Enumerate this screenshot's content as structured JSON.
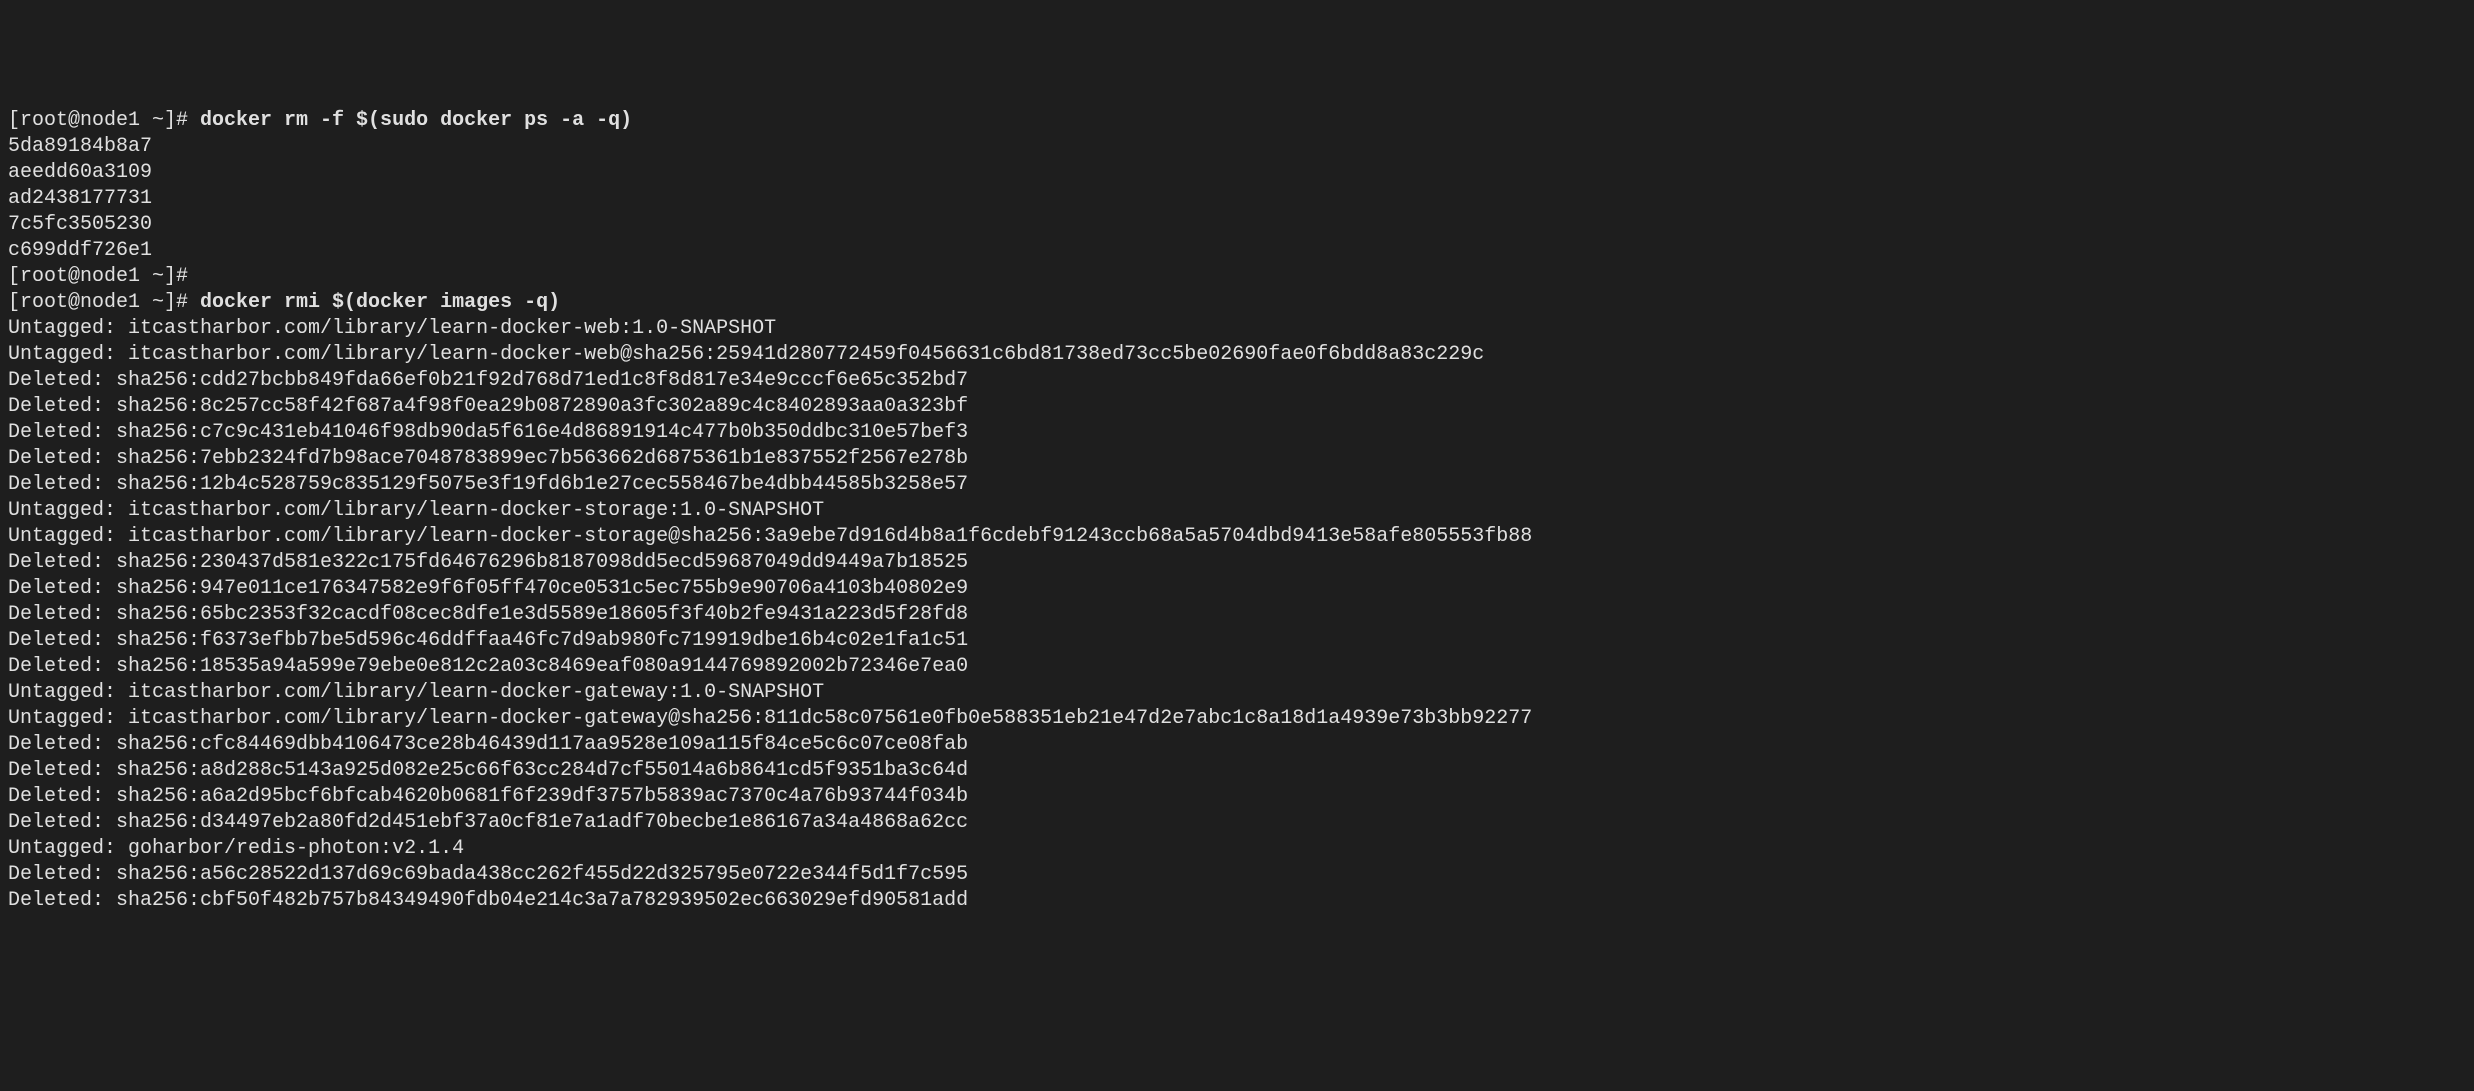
{
  "lines": [
    {
      "type": "prompt",
      "prompt": "[root@node1 ~]# ",
      "command": "docker rm -f $(sudo docker ps -a -q)"
    },
    {
      "type": "output",
      "text": "5da89184b8a7"
    },
    {
      "type": "output",
      "text": "aeedd60a3109"
    },
    {
      "type": "output",
      "text": "ad2438177731"
    },
    {
      "type": "output",
      "text": "7c5fc3505230"
    },
    {
      "type": "output",
      "text": "c699ddf726e1"
    },
    {
      "type": "prompt",
      "prompt": "[root@node1 ~]# ",
      "command": ""
    },
    {
      "type": "prompt",
      "prompt": "[root@node1 ~]# ",
      "command": "docker rmi $(docker images -q)"
    },
    {
      "type": "output",
      "text": "Untagged: itcastharbor.com/library/learn-docker-web:1.0-SNAPSHOT"
    },
    {
      "type": "output",
      "text": "Untagged: itcastharbor.com/library/learn-docker-web@sha256:25941d280772459f0456631c6bd81738ed73cc5be02690fae0f6bdd8a83c229c"
    },
    {
      "type": "output",
      "text": "Deleted: sha256:cdd27bcbb849fda66ef0b21f92d768d71ed1c8f8d817e34e9cccf6e65c352bd7"
    },
    {
      "type": "output",
      "text": "Deleted: sha256:8c257cc58f42f687a4f98f0ea29b0872890a3fc302a89c4c8402893aa0a323bf"
    },
    {
      "type": "output",
      "text": "Deleted: sha256:c7c9c431eb41046f98db90da5f616e4d86891914c477b0b350ddbc310e57bef3"
    },
    {
      "type": "output",
      "text": "Deleted: sha256:7ebb2324fd7b98ace7048783899ec7b563662d6875361b1e837552f2567e278b"
    },
    {
      "type": "output",
      "text": "Deleted: sha256:12b4c528759c835129f5075e3f19fd6b1e27cec558467be4dbb44585b3258e57"
    },
    {
      "type": "output",
      "text": "Untagged: itcastharbor.com/library/learn-docker-storage:1.0-SNAPSHOT"
    },
    {
      "type": "output",
      "text": "Untagged: itcastharbor.com/library/learn-docker-storage@sha256:3a9ebe7d916d4b8a1f6cdebf91243ccb68a5a5704dbd9413e58afe805553fb88"
    },
    {
      "type": "output",
      "text": "Deleted: sha256:230437d581e322c175fd64676296b8187098dd5ecd59687049dd9449a7b18525"
    },
    {
      "type": "output",
      "text": "Deleted: sha256:947e011ce176347582e9f6f05ff470ce0531c5ec755b9e90706a4103b40802e9"
    },
    {
      "type": "output",
      "text": "Deleted: sha256:65bc2353f32cacdf08cec8dfe1e3d5589e18605f3f40b2fe9431a223d5f28fd8"
    },
    {
      "type": "output",
      "text": "Deleted: sha256:f6373efbb7be5d596c46ddffaa46fc7d9ab980fc719919dbe16b4c02e1fa1c51"
    },
    {
      "type": "output",
      "text": "Deleted: sha256:18535a94a599e79ebe0e812c2a03c8469eaf080a9144769892002b72346e7ea0"
    },
    {
      "type": "output",
      "text": "Untagged: itcastharbor.com/library/learn-docker-gateway:1.0-SNAPSHOT"
    },
    {
      "type": "output",
      "text": "Untagged: itcastharbor.com/library/learn-docker-gateway@sha256:811dc58c07561e0fb0e588351eb21e47d2e7abc1c8a18d1a4939e73b3bb92277"
    },
    {
      "type": "output",
      "text": "Deleted: sha256:cfc84469dbb4106473ce28b46439d117aa9528e109a115f84ce5c6c07ce08fab"
    },
    {
      "type": "output",
      "text": "Deleted: sha256:a8d288c5143a925d082e25c66f63cc284d7cf55014a6b8641cd5f9351ba3c64d"
    },
    {
      "type": "output",
      "text": "Deleted: sha256:a6a2d95bcf6bfcab4620b0681f6f239df3757b5839ac7370c4a76b93744f034b"
    },
    {
      "type": "output",
      "text": "Deleted: sha256:d34497eb2a80fd2d451ebf37a0cf81e7a1adf70becbe1e86167a34a4868a62cc"
    },
    {
      "type": "output",
      "text": "Untagged: goharbor/redis-photon:v2.1.4"
    },
    {
      "type": "output",
      "text": "Deleted: sha256:a56c28522d137d69c69bada438cc262f455d22d325795e0722e344f5d1f7c595"
    },
    {
      "type": "output",
      "text": "Deleted: sha256:cbf50f482b757b84349490fdb04e214c3a7a782939502ec663029efd90581add"
    }
  ]
}
